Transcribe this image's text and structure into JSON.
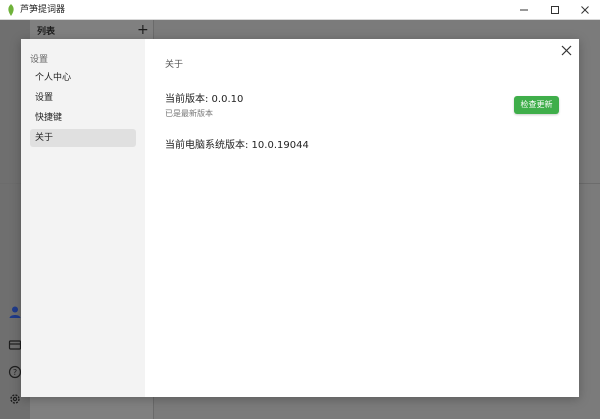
{
  "window": {
    "title": "芦笋提词器",
    "controls": {
      "minimize": "—",
      "maximize": "☐",
      "close": "✕"
    }
  },
  "background": {
    "list_title": "列表",
    "add_symbol": "+",
    "icons": [
      "user-icon",
      "ticket-icon",
      "help-icon",
      "settings-icon"
    ]
  },
  "settings_modal": {
    "sidebar": {
      "group_label": "设置",
      "items": [
        {
          "label": "个人中心",
          "active": false
        },
        {
          "label": "设置",
          "active": false
        },
        {
          "label": "快捷键",
          "active": false
        },
        {
          "label": "关于",
          "active": true
        }
      ]
    },
    "about": {
      "section_title": "关于",
      "current_version": "当前版本: 0.0.10",
      "version_status": "已是最新版本",
      "check_update_label": "检查更新",
      "os_version": "当前电脑系统版本: 10.0.19044"
    },
    "colors": {
      "accent": "#3fae4a"
    }
  }
}
